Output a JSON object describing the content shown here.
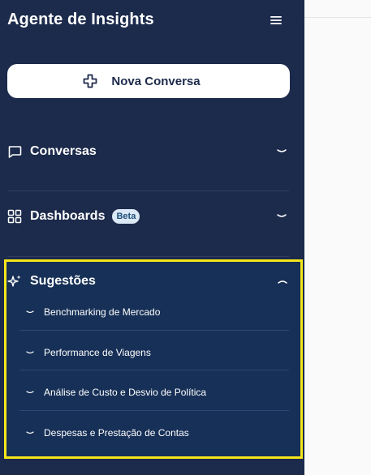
{
  "sidebar": {
    "title": "Agente de Insights",
    "new_chat_label": "Nova Conversa",
    "sections": {
      "conversas": {
        "label": "Conversas",
        "icon": "chat-bubble-icon",
        "state": "collapsed"
      },
      "dashboards": {
        "label": "Dashboards",
        "badge": "Beta",
        "icon": "dashboard-grid-icon",
        "state": "collapsed"
      },
      "sugestoes": {
        "label": "Sugestões",
        "icon": "sparkles-icon",
        "state": "expanded",
        "items": [
          "Benchmarking de Mercado",
          "Performance de Viagens",
          "Análise de Custo e Desvio de Política",
          "Despesas e Prestação de Contas"
        ]
      }
    }
  },
  "colors": {
    "sidebar_bg": "#1c2a4b",
    "suggestions_bg": "#173057",
    "highlight_border": "#f5e61a",
    "badge_bg": "#dbe8f5",
    "badge_text": "#1c4f7a"
  }
}
